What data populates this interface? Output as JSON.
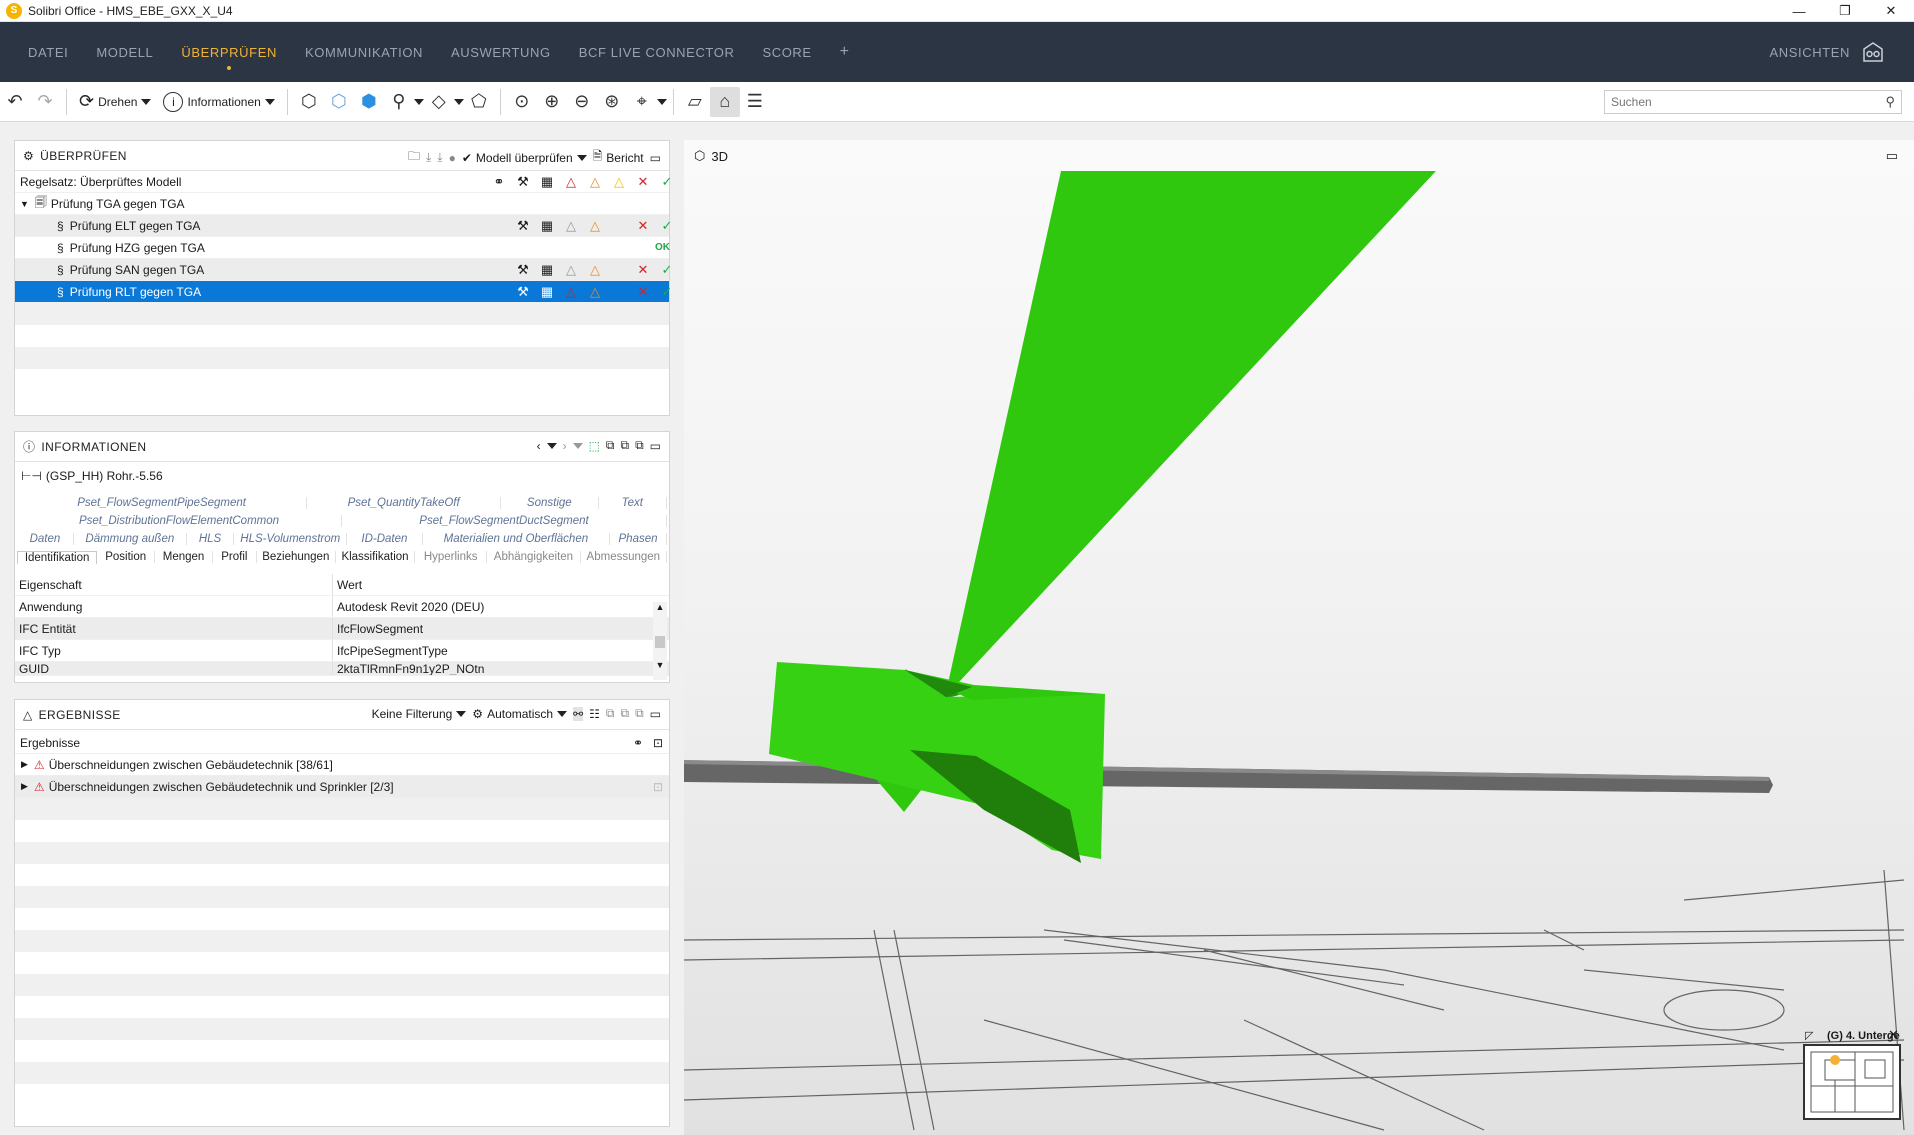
{
  "window": {
    "title": "Solibri Office - HMS_EBE_GXX_X_U4",
    "logo": "S",
    "minimize": "—",
    "restore": "❐",
    "close": "✕"
  },
  "menu": {
    "items": [
      "DATEI",
      "MODELL",
      "ÜBERPRÜFEN",
      "KOMMUNIKATION",
      "AUSWERTUNG",
      "BCF LIVE CONNECTOR",
      "SCORE"
    ],
    "active_index": 2,
    "plus": "+",
    "right_label": "ANSICHTEN"
  },
  "toolbar": {
    "rotate_label": "Drehen",
    "info_label": "Informationen",
    "search_placeholder": "Suchen"
  },
  "check_panel": {
    "title": "ÜBERPRÜFEN",
    "check_model_label": "Modell überprüfen",
    "report_label": "Bericht",
    "ruleset_label": "Regelsatz: Überprüftes Modell",
    "group_label": "Prüfung TGA gegen TGA",
    "rules": [
      {
        "label": "Prüfung ELT gegen TGA",
        "status": "check"
      },
      {
        "label": "Prüfung HZG gegen TGA",
        "status": "ok",
        "ok_text": "OK"
      },
      {
        "label": "Prüfung SAN gegen TGA",
        "status": "check"
      },
      {
        "label": "Prüfung RLT gegen TGA",
        "status": "check"
      }
    ],
    "selected_index": 3
  },
  "info_panel": {
    "title": "INFORMATIONEN",
    "component": "(GSP_HH) Rohr.-5.56",
    "tab_rows": [
      [
        "Pset_FlowSegmentPipeSegment",
        "Pset_QuantityTakeOff",
        "Sonstige",
        "Text"
      ],
      [
        "Pset_DistributionFlowElementCommon",
        "Pset_FlowSegmentDuctSegment"
      ],
      [
        "Daten",
        "Dämmung außen",
        "HLS",
        "HLS-Volumenstrom",
        "ID-Daten",
        "Materialien und Oberflächen",
        "Phasen"
      ]
    ],
    "main_tabs": [
      "Identifikation",
      "Position",
      "Mengen",
      "Profil",
      "Beziehungen",
      "Klassifikation",
      "Hyperlinks",
      "Abhängigkeiten",
      "Abmessungen"
    ],
    "columns": [
      "Eigenschaft",
      "Wert"
    ],
    "properties": [
      {
        "name": "Anwendung",
        "value": "Autodesk Revit 2020 (DEU)"
      },
      {
        "name": "IFC Entität",
        "value": "IfcFlowSegment"
      },
      {
        "name": "IFC Typ",
        "value": "IfcPipeSegmentType"
      },
      {
        "name": "GUID",
        "value": "2ktaTlRmnFn9n1y2P_NOtn"
      }
    ]
  },
  "results_panel": {
    "title": "ERGEBNISSE",
    "filter_label": "Keine Filterung",
    "auto_label": "Automatisch",
    "column": "Ergebnisse",
    "items": [
      "Überschneidungen zwischen Gebäudetechnik [38/61]",
      "Überschneidungen zwischen Gebäudetechnik und Sprinkler [2/3]"
    ]
  },
  "viewport": {
    "label": "3D",
    "minimap_label": "(G) 4. Unterge"
  },
  "colors": {
    "accent": "#f2b233",
    "menubar": "#2b3544",
    "selection": "#0a78d7",
    "model_green": "#2fc80f"
  }
}
